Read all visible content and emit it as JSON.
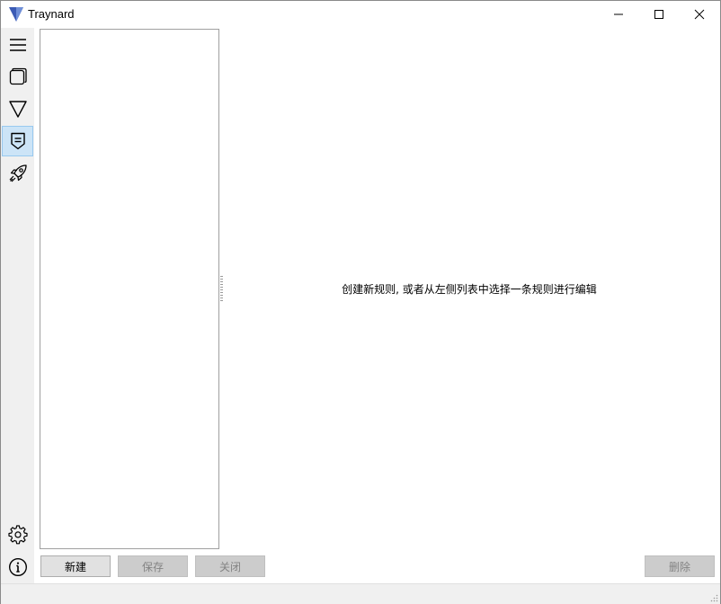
{
  "window": {
    "title": "Traynard",
    "controls": {
      "minimize": "minimize-icon",
      "maximize": "maximize-icon",
      "close": "close-icon"
    },
    "brand_color": "#3b5bb5"
  },
  "sidebar": {
    "items": [
      {
        "icon": "menu-icon",
        "active": false
      },
      {
        "icon": "windows-icon",
        "active": false
      },
      {
        "icon": "triangle-icon",
        "active": false
      },
      {
        "icon": "rule-icon",
        "active": true
      },
      {
        "icon": "rocket-icon",
        "active": false
      }
    ],
    "bottom_items": [
      {
        "icon": "gear-icon"
      },
      {
        "icon": "info-icon"
      }
    ],
    "active_color": "#cce4f7"
  },
  "rule_list": {
    "items": []
  },
  "editor": {
    "placeholder": "创建新规则, 或者从左侧列表中选择一条规则进行编辑"
  },
  "buttons": {
    "new": "新建",
    "save": "保存",
    "close": "关闭",
    "delete": "删除"
  }
}
